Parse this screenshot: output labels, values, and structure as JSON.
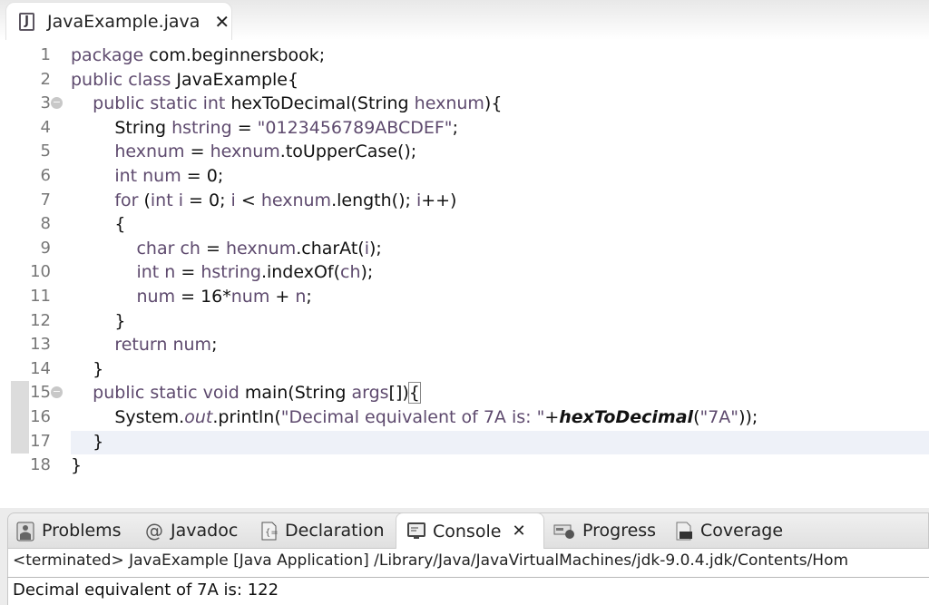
{
  "editor_tab": {
    "filename": "JavaExample.java",
    "icon": "java-file-icon",
    "close_glyph": "✕"
  },
  "code_lines": [
    {
      "n": "1",
      "parts": [
        {
          "t": "package",
          "c": "kw"
        },
        {
          "t": " com.beginnersbook;",
          "c": ""
        }
      ]
    },
    {
      "n": "2",
      "parts": [
        {
          "t": "public class",
          "c": "kw"
        },
        {
          "t": " JavaExample{",
          "c": ""
        }
      ]
    },
    {
      "n": "3",
      "fold": true,
      "parts": [
        {
          "t": "    public static int",
          "c": "kw"
        },
        {
          "t": " hexToDecimal(String ",
          "c": ""
        },
        {
          "t": "hexnum",
          "c": "var"
        },
        {
          "t": "){",
          "c": ""
        }
      ]
    },
    {
      "n": "4",
      "parts": [
        {
          "t": "        String ",
          "c": ""
        },
        {
          "t": "hstring",
          "c": "var"
        },
        {
          "t": " = ",
          "c": ""
        },
        {
          "t": "\"0123456789ABCDEF\"",
          "c": "str"
        },
        {
          "t": ";",
          "c": ""
        }
      ]
    },
    {
      "n": "5",
      "parts": [
        {
          "t": "        ",
          "c": ""
        },
        {
          "t": "hexnum",
          "c": "var"
        },
        {
          "t": " = ",
          "c": ""
        },
        {
          "t": "hexnum",
          "c": "var"
        },
        {
          "t": ".toUpperCase();",
          "c": ""
        }
      ]
    },
    {
      "n": "6",
      "parts": [
        {
          "t": "        int",
          "c": "kw"
        },
        {
          "t": " ",
          "c": ""
        },
        {
          "t": "num",
          "c": "var"
        },
        {
          "t": " = 0;",
          "c": ""
        }
      ]
    },
    {
      "n": "7",
      "parts": [
        {
          "t": "        for",
          "c": "kw"
        },
        {
          "t": " (",
          "c": ""
        },
        {
          "t": "int",
          "c": "kw"
        },
        {
          "t": " ",
          "c": ""
        },
        {
          "t": "i",
          "c": "var"
        },
        {
          "t": " = 0; ",
          "c": ""
        },
        {
          "t": "i",
          "c": "var"
        },
        {
          "t": " < ",
          "c": ""
        },
        {
          "t": "hexnum",
          "c": "var"
        },
        {
          "t": ".length(); ",
          "c": ""
        },
        {
          "t": "i",
          "c": "var"
        },
        {
          "t": "++)",
          "c": ""
        }
      ]
    },
    {
      "n": "8",
      "parts": [
        {
          "t": "        {",
          "c": ""
        }
      ]
    },
    {
      "n": "9",
      "parts": [
        {
          "t": "            char",
          "c": "kw"
        },
        {
          "t": " ",
          "c": ""
        },
        {
          "t": "ch",
          "c": "var"
        },
        {
          "t": " = ",
          "c": ""
        },
        {
          "t": "hexnum",
          "c": "var"
        },
        {
          "t": ".charAt(",
          "c": ""
        },
        {
          "t": "i",
          "c": "var"
        },
        {
          "t": ");",
          "c": ""
        }
      ]
    },
    {
      "n": "10",
      "parts": [
        {
          "t": "            int",
          "c": "kw"
        },
        {
          "t": " ",
          "c": ""
        },
        {
          "t": "n",
          "c": "var"
        },
        {
          "t": " = ",
          "c": ""
        },
        {
          "t": "hstring",
          "c": "var"
        },
        {
          "t": ".indexOf(",
          "c": ""
        },
        {
          "t": "ch",
          "c": "var"
        },
        {
          "t": ");",
          "c": ""
        }
      ]
    },
    {
      "n": "11",
      "parts": [
        {
          "t": "            ",
          "c": ""
        },
        {
          "t": "num",
          "c": "var"
        },
        {
          "t": " = 16*",
          "c": ""
        },
        {
          "t": "num",
          "c": "var"
        },
        {
          "t": " + ",
          "c": ""
        },
        {
          "t": "n",
          "c": "var"
        },
        {
          "t": ";",
          "c": ""
        }
      ]
    },
    {
      "n": "12",
      "parts": [
        {
          "t": "        }",
          "c": ""
        }
      ]
    },
    {
      "n": "13",
      "parts": [
        {
          "t": "        return",
          "c": "kw"
        },
        {
          "t": " ",
          "c": ""
        },
        {
          "t": "num",
          "c": "var"
        },
        {
          "t": ";",
          "c": ""
        }
      ]
    },
    {
      "n": "14",
      "parts": [
        {
          "t": "    }",
          "c": ""
        }
      ]
    },
    {
      "n": "15",
      "fold": true,
      "parts": [
        {
          "t": "    public static void",
          "c": "kw"
        },
        {
          "t": " main(String ",
          "c": ""
        },
        {
          "t": "args",
          "c": "var"
        },
        {
          "t": "[])",
          "c": ""
        },
        {
          "t": "{",
          "c": "bracket-box"
        }
      ]
    },
    {
      "n": "16",
      "parts": [
        {
          "t": "        System.",
          "c": ""
        },
        {
          "t": "out",
          "c": "var it"
        },
        {
          "t": ".println(",
          "c": ""
        },
        {
          "t": "\"Decimal equivalent of 7A is: \"",
          "c": "str"
        },
        {
          "t": "+",
          "c": ""
        },
        {
          "t": "hexToDecimal",
          "c": "bold-it"
        },
        {
          "t": "(",
          "c": ""
        },
        {
          "t": "\"7A\"",
          "c": "str"
        },
        {
          "t": "));",
          "c": ""
        }
      ]
    },
    {
      "n": "17",
      "parts": [
        {
          "t": "    }",
          "c": ""
        }
      ]
    },
    {
      "n": "18",
      "parts": [
        {
          "t": "}",
          "c": ""
        }
      ]
    }
  ],
  "panel_tabs": [
    {
      "label": "Problems",
      "icon": "problems-icon"
    },
    {
      "label": "Javadoc",
      "icon": "at-sign-icon"
    },
    {
      "label": "Declaration",
      "icon": "declaration-icon"
    },
    {
      "label": "Console",
      "icon": "console-icon",
      "active": true,
      "close_glyph": "✕"
    },
    {
      "label": "Progress",
      "icon": "progress-icon"
    },
    {
      "label": "Coverage",
      "icon": "coverage-icon"
    }
  ],
  "console": {
    "header": "<terminated> JavaExample [Java Application] /Library/Java/JavaVirtualMachines/jdk-9.0.4.jdk/Contents/Hom",
    "output": "Decimal equivalent of 7A is: 122"
  }
}
